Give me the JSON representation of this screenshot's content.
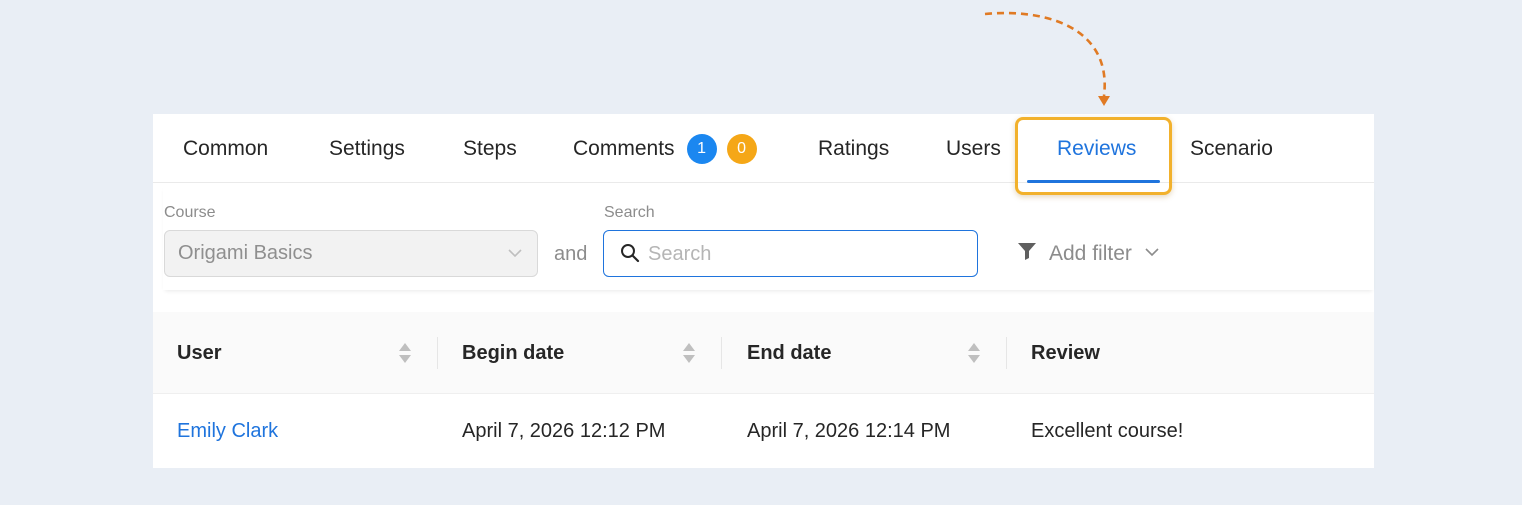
{
  "tabs": [
    {
      "label": "Common"
    },
    {
      "label": "Settings"
    },
    {
      "label": "Steps"
    },
    {
      "label": "Comments",
      "badges": [
        "1",
        "0"
      ]
    },
    {
      "label": "Ratings"
    },
    {
      "label": "Users"
    },
    {
      "label": "Reviews",
      "active": true
    },
    {
      "label": "Scenario"
    }
  ],
  "filters": {
    "course_label": "Course",
    "course_value": "Origami Basics",
    "and_text": "and",
    "search_label": "Search",
    "search_placeholder": "Search",
    "search_value": "",
    "add_filter_label": "Add filter"
  },
  "table": {
    "columns": [
      "User",
      "Begin date",
      "End date",
      "Review"
    ],
    "rows": [
      [
        "Emily Clark",
        "April 7, 2026 12:12 PM",
        "April 7, 2026 12:14 PM",
        "Excellent course!"
      ]
    ]
  },
  "colors": {
    "accent": "#1f74dd",
    "highlight": "#f2b12c",
    "badge_blue": "#1b87f0",
    "badge_orange": "#f5a717",
    "arrow": "#e07a24"
  },
  "icons": [
    "chevron-down-icon",
    "search-icon",
    "filter-icon",
    "sort-icon"
  ]
}
